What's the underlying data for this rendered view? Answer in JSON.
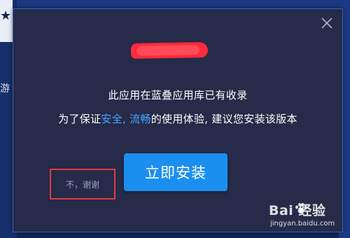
{
  "background": {
    "left_text": "游"
  },
  "dialog": {
    "message_line1": "此应用在蓝叠应用库已有收录",
    "message_line2_before": "为了保证",
    "message_line2_highlight": "安全, 流畅",
    "message_line2_after": "的使用体验, 建议您安装该版本",
    "no_thanks_label": "不，谢谢",
    "install_label": "立即安装"
  },
  "watermark": {
    "text": "Bai 经验",
    "url": "jingyan.baidu.com"
  },
  "colors": {
    "dialog_bg": "#252b48",
    "accent": "#1b8ff0",
    "highlight_text": "#4aa6ff",
    "annotation_red": "#e03a45",
    "redaction": "#ff2a3a"
  }
}
